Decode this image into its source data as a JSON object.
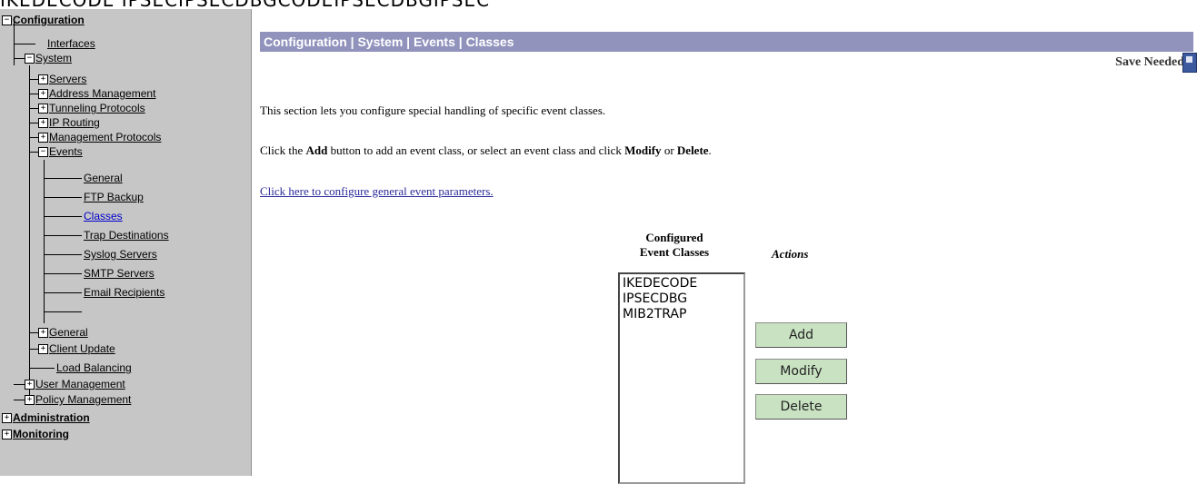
{
  "top_cut_text": "IKEDECODE IPSECIPSECDBGCODEIPSECDBGIPSEC",
  "sidebar": {
    "configuration": "Configuration",
    "interfaces": "Interfaces",
    "system": "System",
    "servers": "Servers",
    "address_management": "Address Management",
    "tunneling_protocols": "Tunneling Protocols",
    "ip_routing": "IP Routing",
    "management_protocols": "Management Protocols",
    "events": "Events",
    "general": "General",
    "ftp_backup": "FTP Backup",
    "classes": "Classes",
    "trap_destinations": "Trap Destinations",
    "syslog_servers": "Syslog Servers",
    "smtp_servers": "SMTP Servers",
    "email_recipients": "Email Recipients",
    "general2": "General",
    "client_update": "Client Update",
    "load_balancing": "Load Balancing",
    "user_management": "User Management",
    "policy_management": "Policy Management",
    "administration": "Administration",
    "monitoring": "Monitoring"
  },
  "main": {
    "breadcrumb": "Configuration | System | Events | Classes",
    "save_needed": "Save Needed",
    "intro": "This section lets you configure special handling of specific event classes.",
    "instr_pre": "Click the ",
    "instr_add": "Add",
    "instr_mid": " button to add an event class, or select an event class and click ",
    "instr_modify": "Modify",
    "instr_or": " or ",
    "instr_delete": "Delete",
    "instr_end": ".",
    "config_link": "Click here to configure general event parameters.",
    "list_header_1": "Configured",
    "list_header_2": "Event Classes",
    "actions_header": "Actions",
    "classes": [
      "IKEDECODE",
      "IPSECDBG",
      "MIB2TRAP"
    ],
    "add_label": "Add",
    "modify_label": "Modify",
    "delete_label": "Delete"
  },
  "colors": {
    "header_bar": "#9193bd",
    "sidebar_bg": "#c6c6c6",
    "button_bg": "#c9e3c2"
  }
}
